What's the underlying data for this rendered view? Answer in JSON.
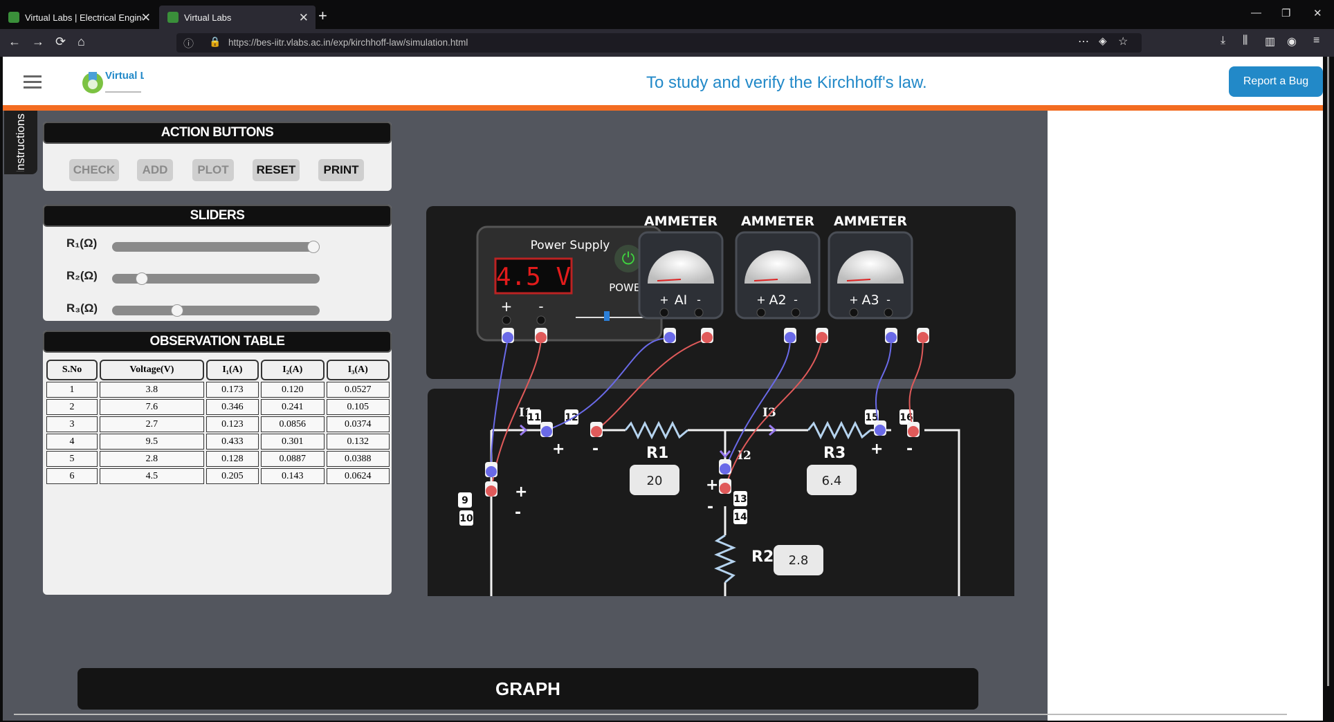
{
  "browser": {
    "tabs": [
      {
        "title": "Virtual Labs | Electrical Enginee"
      },
      {
        "title": "Virtual Labs"
      }
    ],
    "url": "https://bes-iitr.vlabs.ac.in/exp/kirchhoff-law/simulation.html"
  },
  "header": {
    "logo_text": "Virtual Labs",
    "title": "To study and verify the Kirchhoff's law.",
    "report_button": "Report a Bug",
    "instructions_tab": "Instructions"
  },
  "action_buttons": {
    "heading": "ACTION BUTTONS",
    "check": "CHECK",
    "add": "ADD",
    "plot": "PLOT",
    "reset": "RESET",
    "print": "PRINT"
  },
  "sliders": {
    "heading": "SLIDERS",
    "r1_label": "R₁(Ω)",
    "r2_label": "R₂(Ω)",
    "r3_label": "R₃(Ω)",
    "r1_fraction": 1.0,
    "r2_fraction": 0.12,
    "r3_fraction": 0.3
  },
  "observation_table": {
    "heading": "OBSERVATION TABLE",
    "headers": [
      "S.No",
      "Voltage(V)",
      "I₁(A)",
      "I₂(A)",
      "I₃(A)"
    ],
    "rows": [
      [
        "1",
        "3.8",
        "0.173",
        "0.120",
        "0.0527"
      ],
      [
        "2",
        "7.6",
        "0.346",
        "0.241",
        "0.105"
      ],
      [
        "3",
        "2.7",
        "0.123",
        "0.0856",
        "0.0374"
      ],
      [
        "4",
        "9.5",
        "0.433",
        "0.301",
        "0.132"
      ],
      [
        "5",
        "2.8",
        "0.128",
        "0.0887",
        "0.0388"
      ],
      [
        "6",
        "4.5",
        "0.205",
        "0.143",
        "0.0624"
      ]
    ]
  },
  "power_supply": {
    "label": "Power Supply",
    "display": "4.5 V",
    "power_label": "POWER",
    "plus": "+",
    "minus": "-",
    "voltage_fraction": 0.45
  },
  "ammeters": [
    {
      "heading": "AMMETER",
      "name": "AI"
    },
    {
      "heading": "AMMETER",
      "name": "A2"
    },
    {
      "heading": "AMMETER",
      "name": "A3"
    }
  ],
  "circuit": {
    "r1_label": "R1",
    "r2_label": "R2",
    "r3_label": "R3",
    "r1_value": "20",
    "r2_value": "2.8",
    "r3_value": "6.4",
    "i1_label": "I1",
    "i2_label": "I2",
    "i3_label": "I3",
    "terminals": [
      "9",
      "10",
      "11",
      "12",
      "13",
      "14",
      "15",
      "16"
    ]
  },
  "graph": {
    "heading": "GRAPH"
  },
  "colors": {
    "accent": "#2289c8",
    "orange_bar": "#f36c21",
    "wire_red": "#e05a5a",
    "wire_blue": "#6a6ae8"
  }
}
